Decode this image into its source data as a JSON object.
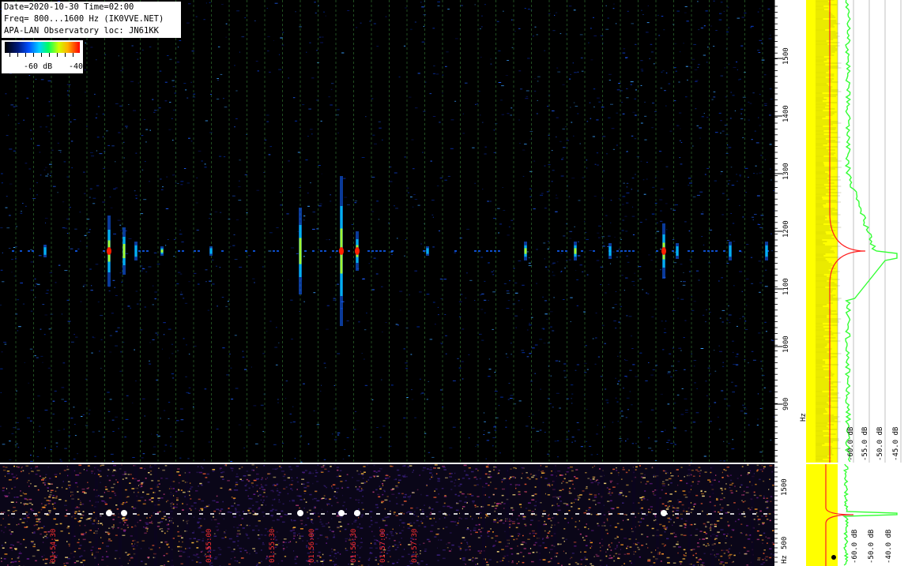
{
  "info": {
    "line1": "Date=2020-10-30 Time=02:00",
    "line2": "Freq= 800...1600 Hz (IK0VVE.NET)",
    "line3": "APA-LAN Observatory loc: JN61KK"
  },
  "colorbar": {
    "label_left": "-60 dB",
    "label_right": "-40"
  },
  "freq_axis": {
    "unit_label": "Hz",
    "ticks": [
      "1500",
      "1400",
      "1300",
      "1200",
      "1100",
      "1000",
      "900"
    ]
  },
  "freq_axis_bottom": {
    "ticks": [
      "1500",
      "500"
    ],
    "unit_label": "Hz"
  },
  "db_axis": {
    "labels": [
      "-60.0 dB",
      "-55.0 dB",
      "-50.0 dB",
      "-45.0 dB"
    ]
  },
  "db_axis_bottom": {
    "labels": [
      "-60.0 dB",
      "-50.0 dB",
      "-40.0 dB"
    ]
  },
  "time_labels": [
    "01:54:30",
    "01:55:00",
    "01:55:30",
    "01:56:00",
    "01:56:30",
    "01:57:00",
    "01:57:30"
  ],
  "colors": {
    "grid": "#3a8a3a",
    "trace_yellow": "#ffff00",
    "trace_green": "#33ff33",
    "trace_red": "#ff2020"
  },
  "meteor_echoes": [
    {
      "t": 57,
      "strength": 0.35,
      "len": 8
    },
    {
      "t": 138,
      "strength": 1.0,
      "len": 45
    },
    {
      "t": 157,
      "strength": 0.7,
      "len": 30
    },
    {
      "t": 172,
      "strength": 0.4,
      "len": 12
    },
    {
      "t": 205,
      "strength": 0.6,
      "len": 6
    },
    {
      "t": 267,
      "strength": 0.45,
      "len": 6
    },
    {
      "t": 380,
      "strength": 0.8,
      "len": 55
    },
    {
      "t": 432,
      "strength": 0.9,
      "len": 95
    },
    {
      "t": 452,
      "strength": 1.0,
      "len": 25
    },
    {
      "t": 541,
      "strength": 0.4,
      "len": 6
    },
    {
      "t": 665,
      "strength": 0.6,
      "len": 12
    },
    {
      "t": 728,
      "strength": 0.6,
      "len": 12
    },
    {
      "t": 772,
      "strength": 0.5,
      "len": 10
    },
    {
      "t": 840,
      "strength": 1.0,
      "len": 35
    },
    {
      "t": 857,
      "strength": 0.5,
      "len": 10
    },
    {
      "t": 924,
      "strength": 0.5,
      "len": 12
    },
    {
      "t": 970,
      "strength": 0.55,
      "len": 12
    }
  ]
}
